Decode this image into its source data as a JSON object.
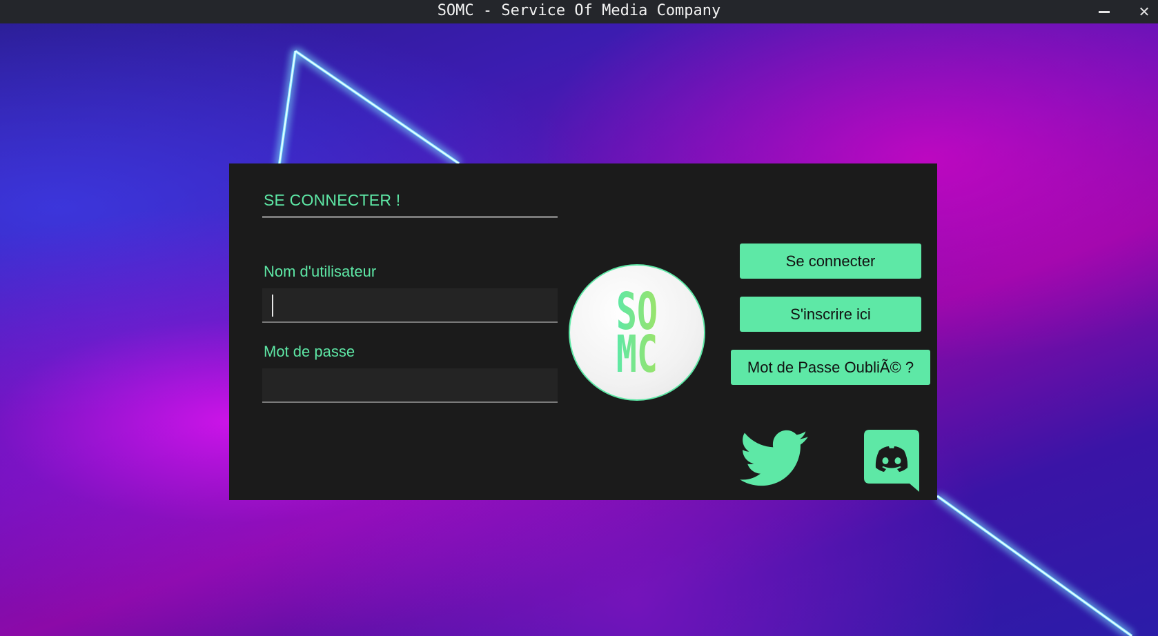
{
  "window": {
    "title": "SOMC - Service Of Media Company",
    "minimize_icon": "minimize-icon",
    "close_glyph": "✕"
  },
  "login": {
    "heading": "SE CONNECTER !",
    "username_label": "Nom d'utilisateur",
    "username_value": "",
    "password_label": "Mot de passe",
    "password_value": ""
  },
  "logo": {
    "line1": "SO",
    "line2": "MC"
  },
  "buttons": {
    "login": "Se connecter",
    "register": "S'inscrire ici",
    "forgot": "Mot de Passe OubliÃ© ?"
  },
  "social": {
    "twitter_icon": "twitter-icon",
    "discord_icon": "discord-icon"
  },
  "colors": {
    "accent": "#5ee8a6",
    "panel": "#1b1b1b",
    "field": "#242424",
    "titlebar": "#24262b"
  }
}
